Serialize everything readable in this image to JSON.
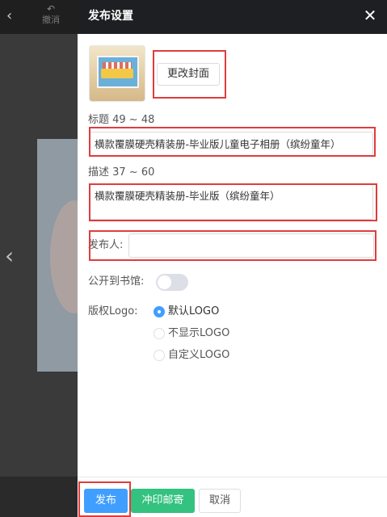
{
  "editor": {
    "undo_label": "撤消"
  },
  "drawer": {
    "title": "发布设置",
    "change_cover_label": "更改封面",
    "title_field": {
      "label": "标题 49 ~ 48",
      "value": "横款覆膜硬壳精装册-毕业版儿童电子相册（缤纷童年）"
    },
    "desc_field": {
      "label": "描述 37 ~ 60",
      "value": "横款覆膜硬壳精装册-毕业版（缤纷童年）"
    },
    "publisher_field": {
      "label": "发布人:",
      "value": ""
    },
    "library": {
      "label": "公开到书馆:",
      "enabled": false
    },
    "logo": {
      "label": "版权Logo:",
      "options": [
        "默认LOGO",
        "不显示LOGO",
        "自定义LOGO"
      ],
      "selected": "默认LOGO"
    },
    "footer": {
      "publish_label": "发布",
      "print_label": "冲印邮寄",
      "cancel_label": "取消"
    }
  },
  "colors": {
    "primary": "#409eff",
    "success": "#33c27f",
    "header_bg": "#1e1f23",
    "annotation": "#e03c3c"
  }
}
